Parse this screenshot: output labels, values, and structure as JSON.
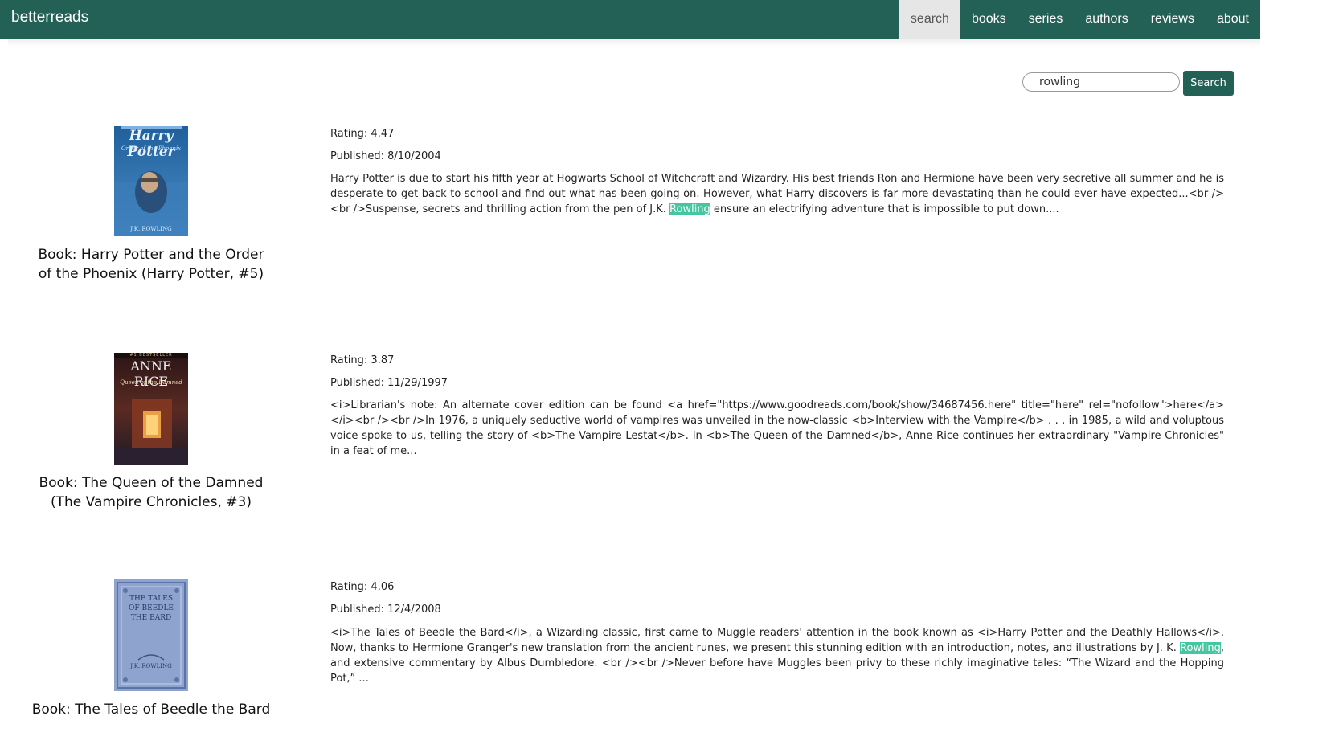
{
  "brand": "betterreads",
  "nav": [
    "search",
    "books",
    "series",
    "authors",
    "reviews",
    "about"
  ],
  "search": {
    "value": "rowling",
    "button": "Search"
  },
  "results": [
    {
      "title": "Book: Harry Potter and the Order of the Phoenix (Harry Potter, #5)",
      "rating": "Rating: 4.47",
      "published": "Published: 8/10/2004",
      "desc_before": "Harry Potter is due to start his fifth year at Hogwarts School of Witchcraft and Wizardry. His best friends Ron and Hermione have been very secretive all summer and he is desperate to get back to school and find out what has been going on. However, what Harry discovers is far more devastating than he could ever have expected...<br /><br />Suspense, secrets and thrilling action from the pen of J.K. ",
      "desc_highlight": "Rowling",
      "desc_after": " ensure an electrifying adventure that is impossible to put down....",
      "cover": {
        "top_text": "Harry Potter",
        "sub_text": "Order of the Phoenix",
        "author_text": "J.K. ROWLING",
        "color": "#2d6fa8"
      }
    },
    {
      "title": "Book: The Queen of the Damned (The Vampire Chronicles, #3)",
      "rating": "Rating: 3.87",
      "published": "Published: 11/29/1997",
      "desc_before": "<i>Librarian's note: An alternate cover edition can be found <a href=\"https://www.goodreads.com/book/show/34687456.here\" title=\"here\" rel=\"nofollow\">here</a></i><br /><br />In 1976, a uniquely seductive world of vampires was unveiled in the now-classic <b>Interview with the Vampire</b> . . . in 1985, a wild and voluptous voice spoke to us, telling the story of <b>The Vampire Lestat</b>.  In <b>The Queen of the Damned</b>, Anne Rice continues her extraordinary \"Vampire Chronicles\" in a feat of me...",
      "desc_highlight": "",
      "desc_after": "",
      "cover": {
        "top_text": "#1 BESTSELLER",
        "sub_text": "ANNE RICE",
        "author_text": "Queen of the Damned",
        "color": "#3a1e1e"
      }
    },
    {
      "title": "Book: The Tales of Beedle the Bard",
      "rating": "Rating: 4.06",
      "published": "Published: 12/4/2008",
      "desc_before": "<i>The Tales of Beedle the Bard</i>, a Wizarding classic, first came to Muggle readers' attention in the book known as <i>Harry Potter and the Deathly Hallows</i>. Now, thanks to Hermione Granger's new translation from the ancient runes, we present this stunning edition with an introduction, notes, and illustrations by J. K. ",
      "desc_highlight": "Rowling",
      "desc_after": ", and extensive commentary by Albus Dumbledore. <br /><br />Never before have Muggles been privy to these richly imaginative tales: “The Wizard and the Hopping Pot,” ...",
      "cover": {
        "top_text": "THE TALES OF BEEDLE THE BARD",
        "sub_text": "",
        "author_text": "J.K. ROWLING",
        "color": "#8ea4cf"
      }
    }
  ]
}
